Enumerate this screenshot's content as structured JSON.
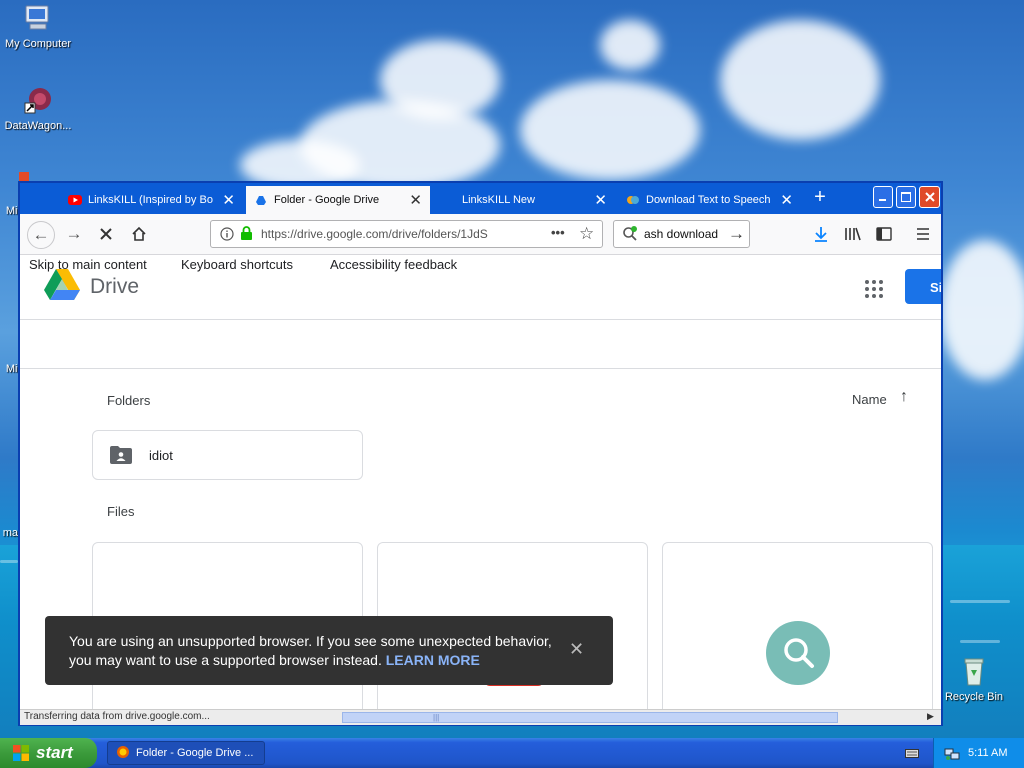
{
  "desktop": {
    "icons": [
      {
        "label": "My Computer",
        "icon": "my-computer-icon"
      },
      {
        "label": "DataWagon...",
        "icon": "datawagon-icon"
      },
      {
        "label": "Mic",
        "icon": "microsoft-app-icon"
      },
      {
        "label": "Mic",
        "icon": "microsoft-app-icon"
      },
      {
        "label": "ma",
        "icon": "app-icon"
      },
      {
        "label": "Recycle Bin",
        "icon": "recycle-bin-icon"
      }
    ]
  },
  "browser": {
    "tabs": [
      {
        "label": "LinksKILL (Inspired by Bor",
        "icon": "youtube-icon",
        "active": false
      },
      {
        "label": "Folder - Google Drive",
        "icon": "drive-icon",
        "active": true
      },
      {
        "label": "LinksKILL New",
        "icon": "",
        "active": false
      },
      {
        "label": "Download Text to Speech",
        "icon": "cloud-icon",
        "active": false
      }
    ],
    "new_tab": "+",
    "url": "https://drive.google.com/drive/folders/1JdS",
    "search_value": "ash download",
    "status_text": "Transferring data from drive.google.com..."
  },
  "page": {
    "skip_links": [
      "Skip to main content",
      "Keyboard shortcuts",
      "Accessibility feedback"
    ],
    "brand": "Drive",
    "signin_label": "Si",
    "folders_heading": "Folders",
    "sort_label": "Name",
    "folders": [
      {
        "name": "idiot"
      }
    ],
    "files_heading": "Files",
    "toast": {
      "message": "You are using an unsupported browser. If you see some unexpected behavior, you may want to use a supported browser instead.",
      "link": "LEARN MORE"
    }
  },
  "taskbar": {
    "start_label": "start",
    "items": [
      {
        "label": "Folder - Google Drive ..."
      }
    ],
    "clock": "5:11 AM"
  },
  "colors": {
    "drive_blue": "#1a73e8",
    "xp_taskbar": "#245edb",
    "start_green": "#3c9b3c",
    "toast_bg": "#323232",
    "learn_more": "#8ab4f8",
    "loader": "#79bdb6"
  }
}
